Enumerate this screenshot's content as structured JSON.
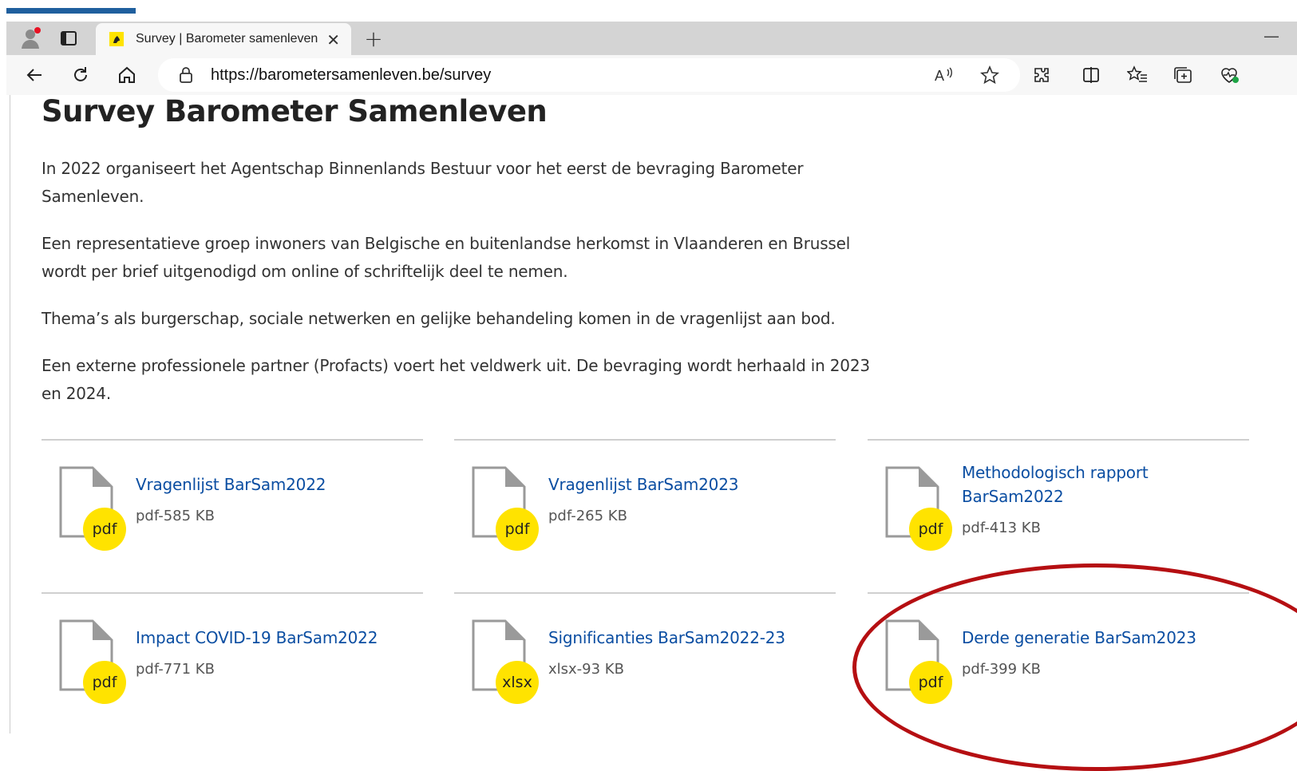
{
  "browser": {
    "tab_title": "Survey | Barometer samenleven",
    "tab_close": "✕",
    "new_tab": "+",
    "minimize": "—",
    "url": "https://barometersamenleven.be/survey",
    "accent_color": "#1f5f9e"
  },
  "page": {
    "title": "Survey Barometer Samenleven",
    "paragraphs": [
      "In 2022 organiseert het Agentschap Binnenlands Bestuur voor het eerst de bevraging Barometer Samenleven.",
      "Een representatieve groep inwoners van Belgische en buitenlandse herkomst in Vlaanderen en Brussel wordt per brief uitgenodigd om online of schriftelijk deel te nemen.",
      "Thema’s als burgerschap, sociale netwerken en gelijke behandeling komen in de vragenlijst aan bod.",
      "Een externe professionele partner (Profacts) voert het veldwerk uit. De bevraging wordt herhaald in 2023 en 2024."
    ],
    "files": [
      {
        "title": "Vragenlijst BarSam2022",
        "meta": "pdf-585 KB",
        "type": "pdf"
      },
      {
        "title": "Vragenlijst BarSam2023",
        "meta": "pdf-265 KB",
        "type": "pdf"
      },
      {
        "title": "Methodologisch rapport BarSam2022",
        "meta": "pdf-413 KB",
        "type": "pdf"
      },
      {
        "title": "Impact COVID-19 BarSam2022",
        "meta": "pdf-771 KB",
        "type": "pdf"
      },
      {
        "title": "Significanties BarSam2022-23",
        "meta": "xlsx-93 KB",
        "type": "xlsx"
      },
      {
        "title": "Derde generatie BarSam2023",
        "meta": "pdf-399 KB",
        "type": "pdf"
      }
    ],
    "link_color": "#0b4ea2",
    "badge_color": "#ffe300",
    "highlight_color": "#b50f12"
  }
}
